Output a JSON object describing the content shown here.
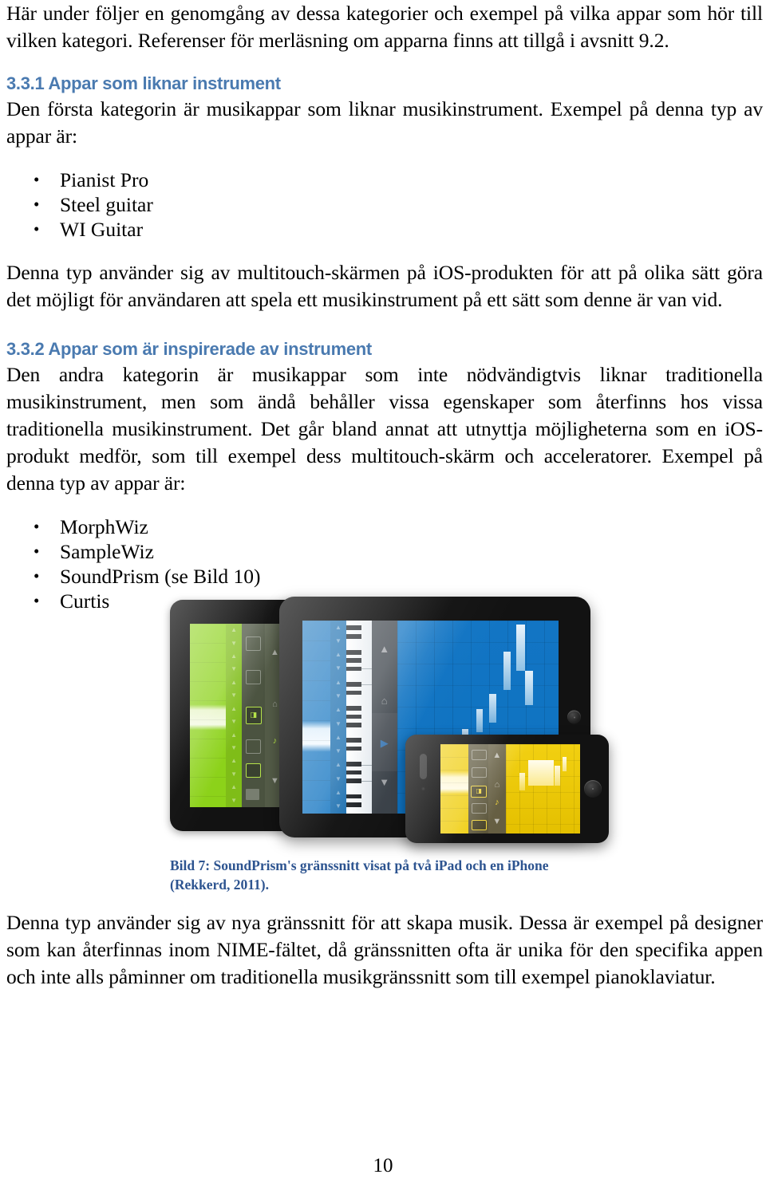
{
  "document": {
    "page_number": "10",
    "accent_heading_color": "#4a7ab0",
    "caption_color": "#2d5490"
  },
  "intro": {
    "paragraph": "Här under följer en genomgång av dessa kategorier och exempel på vilka appar som hör till vilken kategori. Referenser för merläsning om apparna finns att tillgå i avsnitt 9.2."
  },
  "section_331": {
    "heading": "3.3.1 Appar som liknar instrument",
    "paragraph": "Den första kategorin är musikappar som liknar musikinstrument. Exempel på denna typ av appar är:",
    "bullet": "•",
    "items": [
      {
        "label": "Pianist Pro"
      },
      {
        "label": "Steel guitar"
      },
      {
        "label": "WI Guitar"
      }
    ],
    "closing_paragraph": "Denna typ använder sig av multitouch-skärmen på iOS-produkten för att på olika sätt göra det möjligt för användaren att spela ett musikinstrument på ett sätt som denne är van vid."
  },
  "section_332": {
    "heading": "3.3.2 Appar som är inspirerade av instrument",
    "paragraph": "Den andra kategorin är musikappar som inte nödvändigtvis liknar traditionella musikinstrument, men som ändå behåller vissa egenskaper som återfinns hos vissa traditionella musikinstrument. Det går bland annat att utnyttja möjligheterna som en iOS-produkt medför, som till exempel dess multitouch-skärm och acceleratorer. Exempel på denna typ av appar är:",
    "bullet": "•",
    "items": [
      {
        "label": "MorphWiz"
      },
      {
        "label": "SampleWiz"
      },
      {
        "label": "SoundPrism (se Bild 10)"
      },
      {
        "label": "Curtis"
      }
    ],
    "closing_paragraph": "Denna typ använder sig av nya gränssnitt för att skapa musik. Dessa är exempel på designer som kan återfinnas inom NIME-fältet, då gränssnitten ofta är unika för den specifika appen och inte alls påminner om traditionella musikgränssnitt som till exempel pianoklaviatur."
  },
  "figure": {
    "caption": "Bild 7: SoundPrism's gränssnitt visat på två iPad och en iPhone (Rekkerd, 2011).",
    "devices": [
      {
        "name": "ipad-green",
        "app_color": "#8CD219",
        "app_color_dark": "#5f8f12",
        "arrow_up": "▲",
        "arrow_down": "▼"
      },
      {
        "name": "ipad-blue",
        "app_color": "#0E72C0",
        "app_color_dark": "#0a4f87",
        "arrow_up": "▲",
        "arrow_down": "▼"
      },
      {
        "name": "iphone-yellow",
        "app_color": "#EFCB00",
        "app_color_dark": "#b69b00",
        "arrow_up": "▲",
        "arrow_down": "▼"
      }
    ]
  }
}
